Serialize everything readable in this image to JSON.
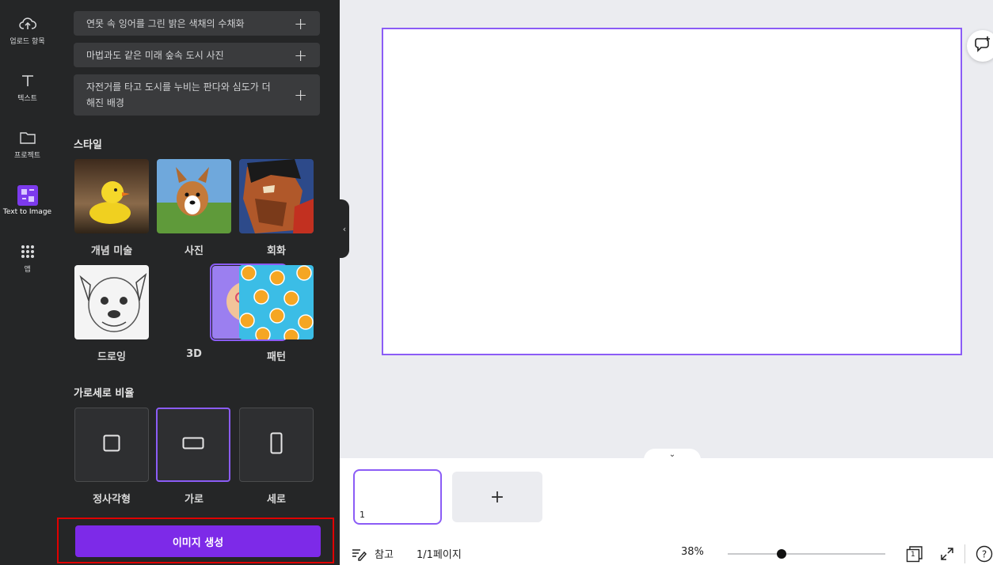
{
  "rail": {
    "items": [
      {
        "label": "업로드 항목",
        "icon": "cloud-upload-icon"
      },
      {
        "label": "텍스트",
        "icon": "text-icon"
      },
      {
        "label": "프로젝트",
        "icon": "folder-icon"
      },
      {
        "label": "Text to Image",
        "icon": "text-to-image-icon"
      },
      {
        "label": "앱",
        "icon": "apps-grid-icon"
      }
    ]
  },
  "panel": {
    "prompts": [
      "연못 속 잉어를 그린 밝은 색채의 수채화",
      "마법과도 같은 미래 숲속 도시 사진",
      "자전거를 타고 도시를 누비는 판다와 심도가 더해진 배경"
    ],
    "style_title": "스타일",
    "styles": [
      {
        "label": "개념 미술",
        "image": "rubber-duck"
      },
      {
        "label": "사진",
        "image": "corgi-dog"
      },
      {
        "label": "회화",
        "image": "abstract-portrait"
      },
      {
        "label": "드로잉",
        "image": "pug-sketch"
      },
      {
        "label": "3D",
        "image": "3d-character",
        "selected": true
      },
      {
        "label": "패턴",
        "image": "orange-pattern"
      }
    ],
    "ratio_title": "가로세로 비율",
    "ratios": [
      {
        "label": "정사각형",
        "icon": "square-icon"
      },
      {
        "label": "가로",
        "icon": "landscape-icon",
        "selected": true
      },
      {
        "label": "세로",
        "icon": "portrait-icon"
      }
    ],
    "generate_label": "이미지 생성"
  },
  "bottom": {
    "page_number": "1",
    "notes_label": "참고",
    "page_counter": "1/1페이지",
    "zoom": "38%",
    "zoom_level_percent": 38,
    "grid_page_number": "1"
  },
  "colors": {
    "accent": "#8b5cf6",
    "generate": "#7d2ae8",
    "highlight": "#e00000"
  }
}
